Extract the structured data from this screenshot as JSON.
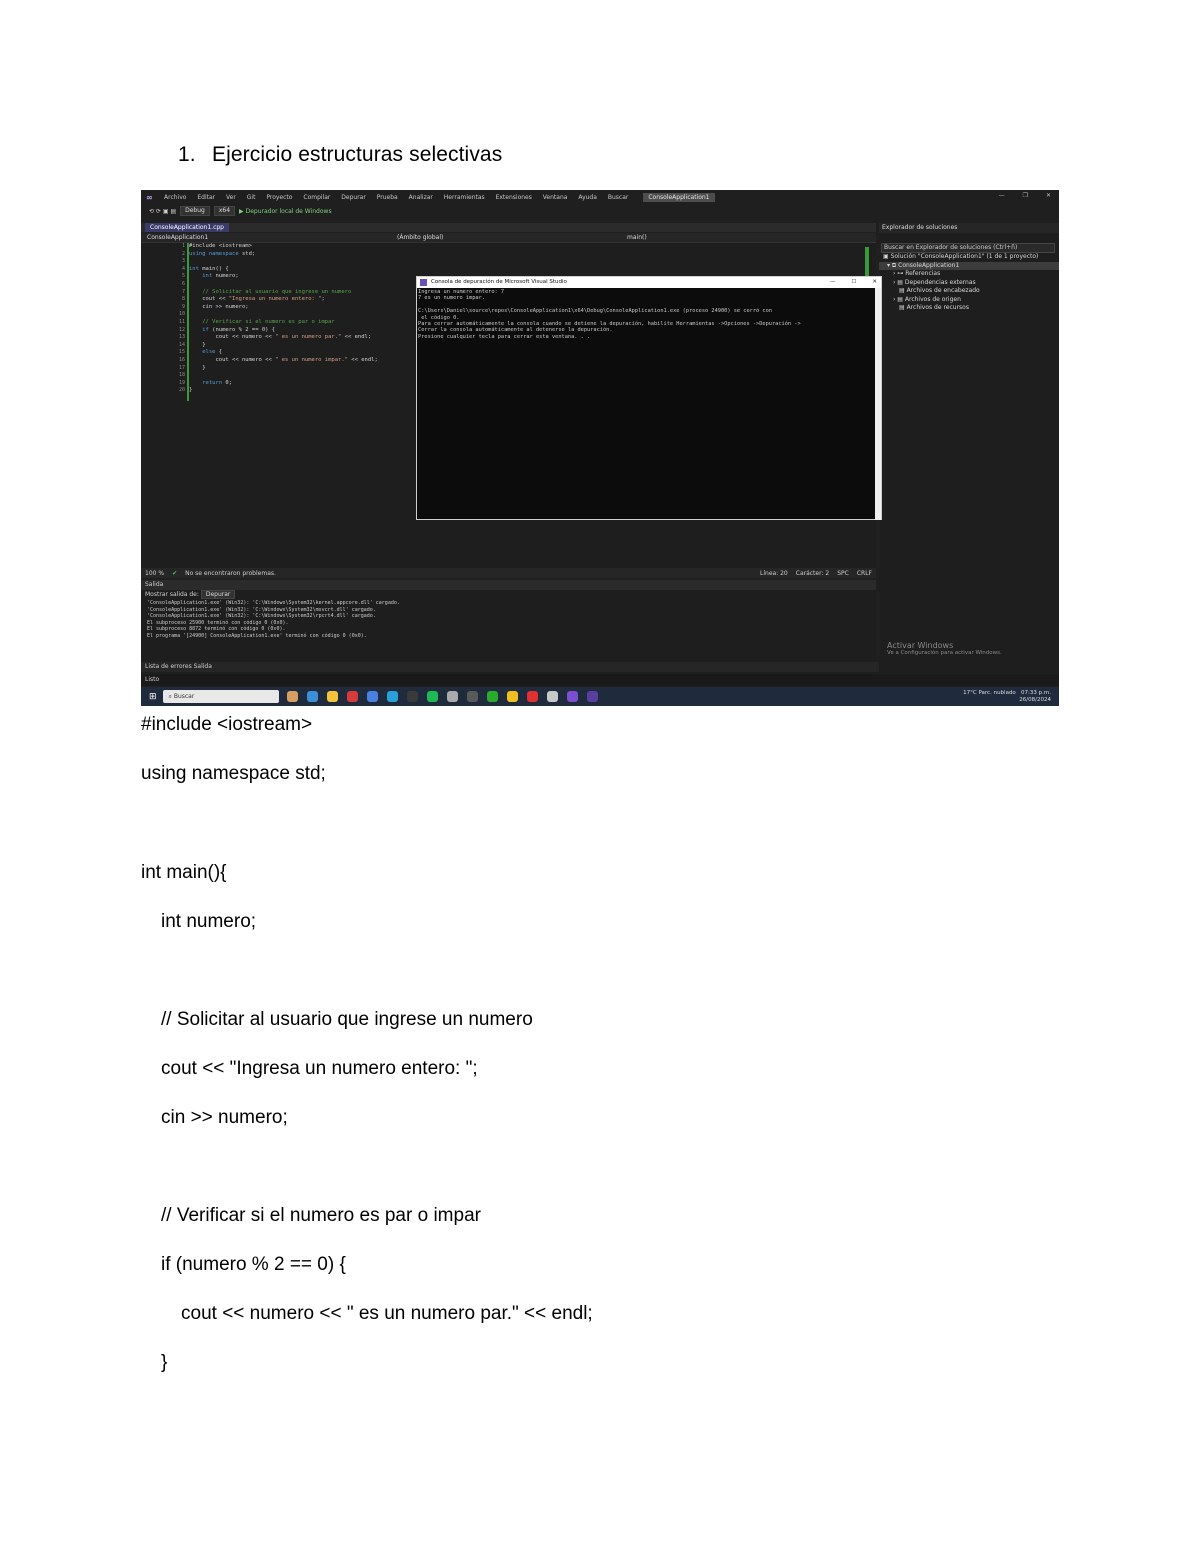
{
  "heading": {
    "number": "1.",
    "text": "Ejercicio estructuras selectivas"
  },
  "screenshot": {
    "menu": [
      "Archivo",
      "Editar",
      "Ver",
      "Git",
      "Proyecto",
      "Compilar",
      "Depurar",
      "Prueba",
      "Analizar",
      "Herramientas",
      "Extensiones",
      "Ventana",
      "Ayuda",
      "Buscar"
    ],
    "solution_badge": "ConsoleApplication1",
    "toolbar": {
      "config": "Debug",
      "platform": "x64",
      "run": "▶ Depurador local de Windows"
    },
    "tab": "ConsoleApplication1.cpp",
    "nav": {
      "project": "ConsoleApplication1",
      "scope": "(Ámbito global)",
      "member": "main()"
    },
    "editor_lines": [
      "#include <iostream>",
      "using namespace std;",
      "",
      "int main() {",
      "    int numero;",
      "",
      "    // Solicitar al usuario que ingrese un numero",
      "    cout << \"Ingresa un numero entero: \";",
      "    cin >> numero;",
      "",
      "    // Verificar si el numero es par o impar",
      "    if (numero % 2 == 0) {",
      "        cout << numero << \" es un numero par.\" << endl;",
      "    }",
      "    else {",
      "        cout << numero << \" es un numero impar.\" << endl;",
      "    }",
      "",
      "    return 0;",
      "}"
    ],
    "status": {
      "zoom": "100 %",
      "issues": "No se encontraron problemas.",
      "line": "Línea: 20",
      "col": "Carácter: 2",
      "spc": "SPC",
      "crlf": "CRLF"
    },
    "output": {
      "title": "Salida",
      "source_label": "Mostrar salida de:",
      "source_value": "Depurar",
      "lines": [
        "'ConsoleApplication1.exe' (Win32): 'C:\\Windows\\System32\\kernel.appcore.dll' cargado.",
        "'ConsoleApplication1.exe' (Win32): 'C:\\Windows\\System32\\msvcrt.dll' cargado.",
        "'ConsoleApplication1.exe' (Win32): 'C:\\Windows\\System32\\rpcrt4.dll' cargado.",
        "El subproceso 25900 terminó con código 0 (0x0).",
        "El subproceso 8872 terminó con código 0 (0x0).",
        "El programa '[24900] ConsoleApplication1.exe' terminó con código 0 (0x0)."
      ],
      "tabs": "Lista de errores   Salida"
    },
    "solution_panel": {
      "title": "Explorador de soluciones",
      "search": "Buscar en Explorador de soluciones (Ctrl+ñ)",
      "items": [
        "Solución \"ConsoleApplication1\" (1 de 1 proyecto)",
        "ConsoleApplication1",
        "Referencias",
        "Dependencias externas",
        "Archivos de encabezado",
        "Archivos de origen",
        "Archivos de recursos"
      ],
      "activate_title": "Activar Windows",
      "activate_sub": "Ve a Configuración para activar Windows."
    },
    "bottom_status": "Listo",
    "console": {
      "title": "Consola de depuración de Microsoft Visual Studio",
      "lines": [
        "Ingresa un numero entero: 7",
        "7 es un numero impar.",
        "",
        "C:\\Users\\Daniel\\source\\repos\\ConsoleApplication1\\x64\\Debug\\ConsoleApplication1.exe (proceso 24900) se cerró con",
        " el código 0.",
        "Para cerrar automáticamente la consola cuando se detiene la depuración, habilite Herramientas ->Opciones ->Depuración ->",
        "Cerrar la consola automáticamente al detenerse la depuración.",
        "Presione cualquier tecla para cerrar esta ventana. . ."
      ]
    },
    "taskbar": {
      "search": "Buscar",
      "weather": "17°C Parc. nublado",
      "time": "07:33 p.m.",
      "date": "26/08/2024"
    }
  },
  "code_listing": [
    "#include <iostream>",
    "using namespace std;",
    "int main(){",
    "int numero;",
    "// Solicitar al usuario que ingrese un numero",
    "cout << \"Ingresa un numero entero: \";",
    "cin >> numero;",
    "// Verificar si el numero es par o impar",
    "if (numero % 2 == 0) {",
    "cout << numero << \" es un numero par.\" << endl;",
    "}"
  ]
}
